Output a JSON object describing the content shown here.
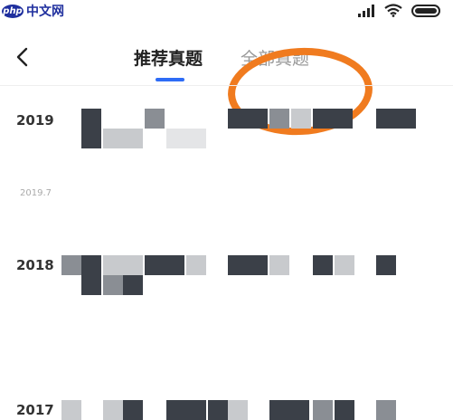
{
  "status_bar": {
    "watermark_badge": "php",
    "watermark_text": "中文网",
    "icons": [
      "signal-icon",
      "wifi-icon",
      "battery-icon"
    ]
  },
  "nav": {
    "back_icon": "chevron-left-icon",
    "tabs": [
      {
        "label": "推荐真题",
        "active": true
      },
      {
        "label": "全部真题",
        "active": false
      }
    ]
  },
  "list": {
    "rows": [
      {
        "year_label": "2019",
        "sub_label": ""
      },
      {
        "year_label": "",
        "sub_label": "2019.7"
      },
      {
        "year_label": "2018",
        "sub_label": ""
      },
      {
        "year_label": "2017",
        "sub_label": ""
      }
    ]
  },
  "colors": {
    "accent": "#2e6cf6",
    "annotation": "#f07b1f",
    "active_tab": "#222222",
    "inactive_tab": "#999999"
  }
}
